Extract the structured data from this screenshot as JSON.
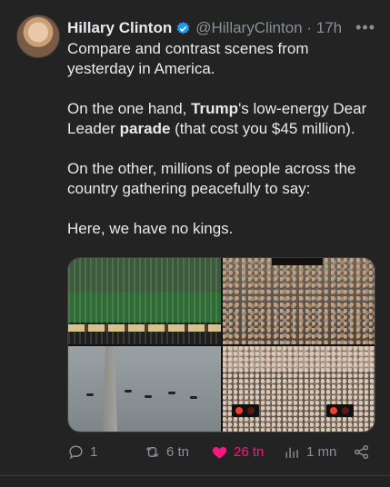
{
  "author": {
    "name": "Hillary Clinton",
    "handle": "@HillaryClinton",
    "time": "17h"
  },
  "tweet": {
    "p1": "Compare and contrast scenes from yesterday in America.",
    "p2_a": "On the one hand, ",
    "p2_b": "Trump",
    "p2_c": "'s low-energy Dear Leader ",
    "p2_d": "parade",
    "p2_e": " (that cost you $45 million).",
    "p3": "On the other, millions of people across the country gathering peacefully to say:",
    "p4": "Here, we have no kings."
  },
  "media": {
    "sign_text": ""
  },
  "actions": {
    "replies": "1",
    "reposts": "6 tn",
    "likes": "26 tn",
    "views": "1 mn"
  },
  "colors": {
    "background": "#232323",
    "like": "#f91880",
    "verified": "#1d9bf0",
    "muted": "#8b8f94"
  },
  "icons": [
    "verified-badge-icon",
    "more-icon",
    "reply-icon",
    "repost-icon",
    "like-icon",
    "views-icon",
    "share-icon"
  ]
}
